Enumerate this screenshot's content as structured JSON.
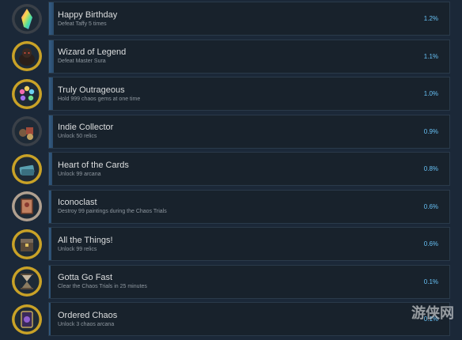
{
  "achievements": [
    {
      "title": "Happy Birthday",
      "desc": "Defeat Taffy 5 times",
      "pct": "1.2%",
      "pct_value": 1.2,
      "icon": "rainbow-crystal-icon",
      "ring": "#3a4048"
    },
    {
      "title": "Wizard of Legend",
      "desc": "Defeat Master Sura",
      "pct": "1.1%",
      "pct_value": 1.1,
      "icon": "dark-wizard-icon",
      "ring": "#c9a227"
    },
    {
      "title": "Truly Outrageous",
      "desc": "Hold 999 chaos gems at one time",
      "pct": "1.0%",
      "pct_value": 1.0,
      "icon": "chaos-gems-icon",
      "ring": "#c9a227"
    },
    {
      "title": "Indie Collector",
      "desc": "Unlock 50 relics",
      "pct": "0.9%",
      "pct_value": 0.9,
      "icon": "relic-pile-icon",
      "ring": "#3a4048"
    },
    {
      "title": "Heart of the Cards",
      "desc": "Unlock 99 arcana",
      "pct": "0.8%",
      "pct_value": 0.8,
      "icon": "arcana-cards-icon",
      "ring": "#c9a227"
    },
    {
      "title": "Iconoclast",
      "desc": "Destroy 99 paintings during the Chaos Trials",
      "pct": "0.6%",
      "pct_value": 0.6,
      "icon": "painting-icon",
      "ring": "#b0a090"
    },
    {
      "title": "All the Things!",
      "desc": "Unlock 99 relics",
      "pct": "0.6%",
      "pct_value": 0.6,
      "icon": "treasure-chest-icon",
      "ring": "#c9a227"
    },
    {
      "title": "Gotta Go Fast",
      "desc": "Clear the Chaos Trials in 25 minutes",
      "pct": "0.1%",
      "pct_value": 0.1,
      "icon": "hourglass-icon",
      "ring": "#c9a227"
    },
    {
      "title": "Ordered Chaos",
      "desc": "Unlock 3 chaos arcana",
      "pct": "0.1%",
      "pct_value": 0.1,
      "icon": "chaos-card-icon",
      "ring": "#c9a227"
    }
  ],
  "watermark": "游侠网",
  "colors": {
    "background": "#1b2838",
    "row": "#18222c",
    "fill": "#345d84",
    "title": "#dcdedf",
    "desc": "#8f98a0",
    "percent": "#67c1f5"
  }
}
